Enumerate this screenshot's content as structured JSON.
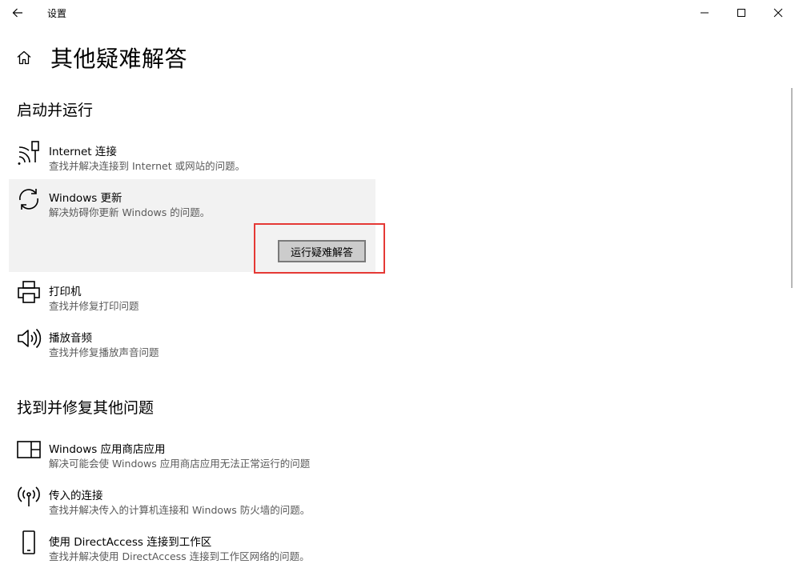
{
  "window": {
    "app_title": "设置"
  },
  "page": {
    "title": "其他疑难解答"
  },
  "sections": [
    {
      "title": "启动并运行",
      "items": [
        {
          "icon": "network-icon",
          "label": "Internet 连接",
          "desc": "查找并解决连接到 Internet 或网站的问题。"
        },
        {
          "icon": "sync-icon",
          "label": "Windows 更新",
          "desc": "解决妨碍你更新 Windows 的问题。",
          "button": "运行疑难解答"
        },
        {
          "icon": "printer-icon",
          "label": "打印机",
          "desc": "查找并修复打印问题"
        },
        {
          "icon": "speaker-icon",
          "label": "播放音频",
          "desc": "查找并修复播放声音问题"
        }
      ]
    },
    {
      "title": "找到并修复其他问题",
      "items": [
        {
          "icon": "store-app-icon",
          "label": "Windows 应用商店应用",
          "desc": "解决可能会使 Windows 应用商店应用无法正常运行的问题"
        },
        {
          "icon": "wireless-icon",
          "label": "传入的连接",
          "desc": "查找并解决传入的计算机连接和 Windows 防火墙的问题。"
        },
        {
          "icon": "phone-icon",
          "label": "使用 DirectAccess 连接到工作区",
          "desc": "查找并解决使用 DirectAccess 连接到工作区网络的问题。"
        }
      ]
    }
  ]
}
